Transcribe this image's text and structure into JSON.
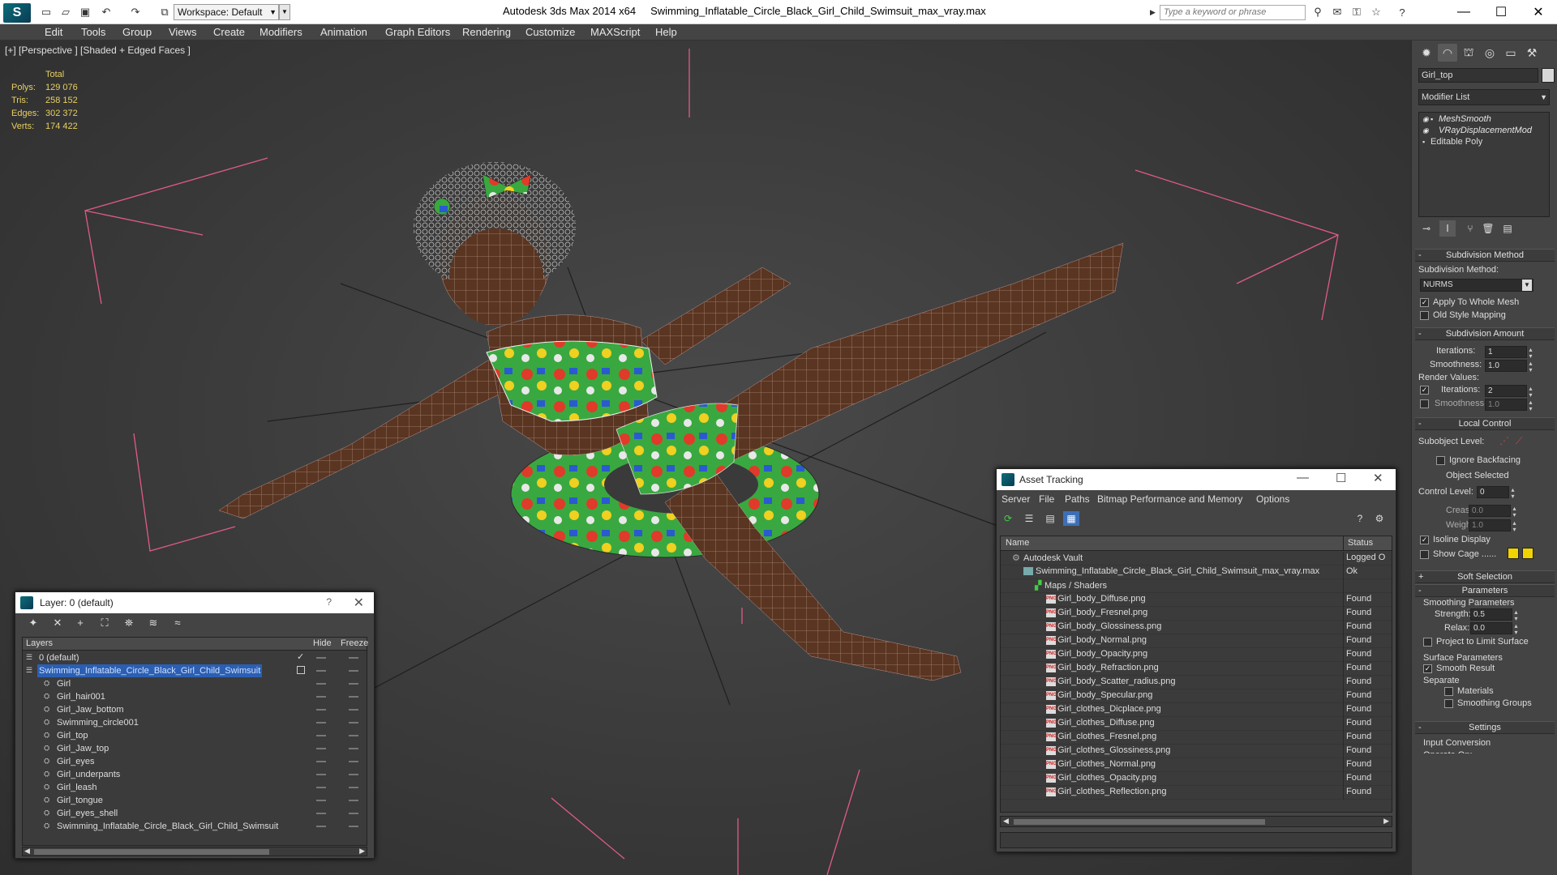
{
  "titlebar": {
    "workspace": "Workspace: Default",
    "app_title": "Autodesk 3ds Max  2014 x64",
    "file_name": "Swimming_Inflatable_Circle_Black_Girl_Child_Swimsuit_max_vray.max",
    "search_placeholder": "Type a keyword or phrase"
  },
  "menu": [
    "Edit",
    "Tools",
    "Group",
    "Views",
    "Create",
    "Modifiers",
    "Animation",
    "Graph Editors",
    "Rendering",
    "Customize",
    "MAXScript",
    "Help"
  ],
  "viewport": {
    "label": "[+] [Perspective ] [Shaded + Edged Faces ]",
    "stats": {
      "header": "Total",
      "rows": [
        {
          "label": "Polys:",
          "value": "129 076"
        },
        {
          "label": "Tris:",
          "value": "258 152"
        },
        {
          "label": "Edges:",
          "value": "302 372"
        },
        {
          "label": "Verts:",
          "value": "174 422"
        }
      ]
    }
  },
  "command_panel": {
    "object_name": "Girl_top",
    "modifier_list": "Modifier List",
    "stack": [
      "MeshSmooth",
      "VRayDisplacementMod",
      "Editable Poly"
    ],
    "subdivision_method": {
      "title": "Subdivision Method",
      "label": "Subdivision Method:",
      "value": "NURMS",
      "apply_whole_mesh": "Apply To Whole Mesh",
      "old_style": "Old Style Mapping"
    },
    "subdivision_amount": {
      "title": "Subdivision Amount",
      "iterations_label": "Iterations:",
      "iterations": "1",
      "smoothness_label": "Smoothness:",
      "smoothness": "1.0",
      "render_values": "Render Values:",
      "r_iterations_label": "Iterations:",
      "r_iterations": "2",
      "r_smoothness_label": "Smoothness:",
      "r_smoothness": "1.0"
    },
    "local_control": {
      "title": "Local Control",
      "subobject_level": "Subobject Level:",
      "ignore_backfacing": "Ignore Backfacing",
      "object_selected": "Object Selected",
      "control_level_label": "Control Level:",
      "control_level": "0",
      "crease_label": "Crease:",
      "crease": "0.0",
      "weight_label": "Weight:",
      "weight": "1.0",
      "isoline": "Isoline Display",
      "show_cage": "Show Cage ......"
    },
    "soft_selection": "Soft Selection",
    "parameters": {
      "title": "Parameters",
      "smoothing_params": "Smoothing Parameters",
      "strength_label": "Strength:",
      "strength": "0.5",
      "relax_label": "Relax:",
      "relax": "0.0",
      "project_limit": "Project to Limit Surface",
      "surface_params": "Surface Parameters",
      "smooth_result": "Smooth Result",
      "separate": "Separate",
      "materials": "Materials",
      "smoothing_groups": "Smoothing Groups"
    },
    "settings": {
      "title": "Settings",
      "input_conversion": "Input Conversion",
      "operate_on": "Operate On:"
    }
  },
  "layer_window": {
    "title": "Layer: 0 (default)",
    "help": "?",
    "columns": [
      "Layers",
      "Hide",
      "Freeze"
    ],
    "rows": [
      {
        "name": "0 (default)",
        "indent": 0,
        "selected": false,
        "check": true
      },
      {
        "name": "Swimming_Inflatable_Circle_Black_Girl_Child_Swimsuit",
        "indent": 0,
        "selected": true,
        "check": false
      },
      {
        "name": "Girl",
        "indent": 1,
        "selected": false,
        "check": false
      },
      {
        "name": "Girl_hair001",
        "indent": 1,
        "selected": false,
        "check": false
      },
      {
        "name": "Girl_Jaw_bottom",
        "indent": 1,
        "selected": false,
        "check": false
      },
      {
        "name": "Swimming_circle001",
        "indent": 1,
        "selected": false,
        "check": false
      },
      {
        "name": "Girl_top",
        "indent": 1,
        "selected": false,
        "check": false
      },
      {
        "name": "Girl_Jaw_top",
        "indent": 1,
        "selected": false,
        "check": false
      },
      {
        "name": "Girl_eyes",
        "indent": 1,
        "selected": false,
        "check": false
      },
      {
        "name": "Girl_underpants",
        "indent": 1,
        "selected": false,
        "check": false
      },
      {
        "name": "Girl_leash",
        "indent": 1,
        "selected": false,
        "check": false
      },
      {
        "name": "Girl_tongue",
        "indent": 1,
        "selected": false,
        "check": false
      },
      {
        "name": "Girl_eyes_shell",
        "indent": 1,
        "selected": false,
        "check": false
      },
      {
        "name": "Swimming_Inflatable_Circle_Black_Girl_Child_Swimsuit",
        "indent": 1,
        "selected": false,
        "check": false
      }
    ]
  },
  "asset_window": {
    "title": "Asset Tracking",
    "menu": [
      "Server",
      "File",
      "Paths",
      "Bitmap Performance and Memory",
      "Options"
    ],
    "columns": [
      "Name",
      "Status"
    ],
    "rows": [
      {
        "name": "Autodesk Vault",
        "status": "Logged O",
        "indent": 1,
        "icon": "vault"
      },
      {
        "name": "Swimming_Inflatable_Circle_Black_Girl_Child_Swimsuit_max_vray.max",
        "status": "Ok",
        "indent": 2,
        "icon": "max"
      },
      {
        "name": "Maps / Shaders",
        "status": "",
        "indent": 3,
        "icon": "folder"
      },
      {
        "name": "Girl_body_Diffuse.png",
        "status": "Found",
        "indent": 4,
        "icon": "png"
      },
      {
        "name": "Girl_body_Fresnel.png",
        "status": "Found",
        "indent": 4,
        "icon": "png"
      },
      {
        "name": "Girl_body_Glossiness.png",
        "status": "Found",
        "indent": 4,
        "icon": "png"
      },
      {
        "name": "Girl_body_Normal.png",
        "status": "Found",
        "indent": 4,
        "icon": "png"
      },
      {
        "name": "Girl_body_Opacity.png",
        "status": "Found",
        "indent": 4,
        "icon": "png"
      },
      {
        "name": "Girl_body_Refraction.png",
        "status": "Found",
        "indent": 4,
        "icon": "png"
      },
      {
        "name": "Girl_body_Scatter_radius.png",
        "status": "Found",
        "indent": 4,
        "icon": "png"
      },
      {
        "name": "Girl_body_Specular.png",
        "status": "Found",
        "indent": 4,
        "icon": "png"
      },
      {
        "name": "Girl_clothes_Dicplace.png",
        "status": "Found",
        "indent": 4,
        "icon": "png"
      },
      {
        "name": "Girl_clothes_Diffuse.png",
        "status": "Found",
        "indent": 4,
        "icon": "png"
      },
      {
        "name": "Girl_clothes_Fresnel.png",
        "status": "Found",
        "indent": 4,
        "icon": "png"
      },
      {
        "name": "Girl_clothes_Glossiness.png",
        "status": "Found",
        "indent": 4,
        "icon": "png"
      },
      {
        "name": "Girl_clothes_Normal.png",
        "status": "Found",
        "indent": 4,
        "icon": "png"
      },
      {
        "name": "Girl_clothes_Opacity.png",
        "status": "Found",
        "indent": 4,
        "icon": "png"
      },
      {
        "name": "Girl_clothes_Reflection.png",
        "status": "Found",
        "indent": 4,
        "icon": "png"
      }
    ]
  },
  "colors": {
    "stats_text": "#e8d060",
    "selection": "#2b5fb3",
    "cage_swatch": "#f2d400",
    "bounding_box": "#e05a8a"
  }
}
